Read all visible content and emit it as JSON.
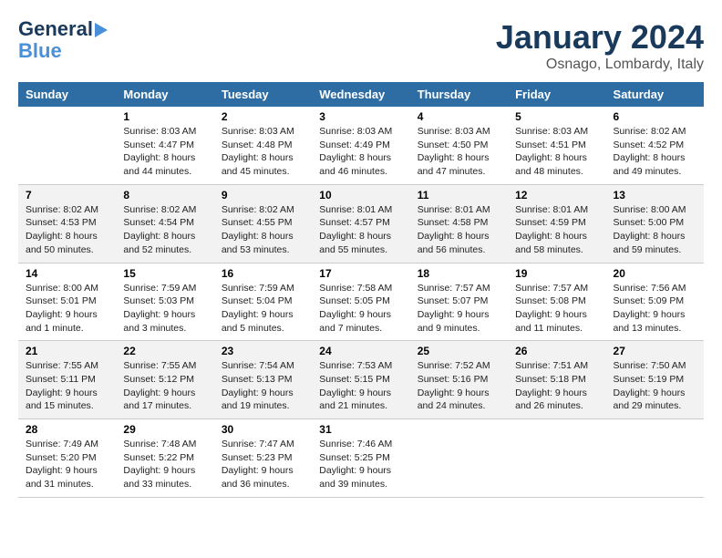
{
  "header": {
    "logo_line1": "General",
    "logo_line2": "Blue",
    "month": "January 2024",
    "location": "Osnago, Lombardy, Italy"
  },
  "columns": [
    "Sunday",
    "Monday",
    "Tuesday",
    "Wednesday",
    "Thursday",
    "Friday",
    "Saturday"
  ],
  "weeks": [
    [
      {
        "day": "",
        "info": ""
      },
      {
        "day": "1",
        "info": "Sunrise: 8:03 AM\nSunset: 4:47 PM\nDaylight: 8 hours\nand 44 minutes."
      },
      {
        "day": "2",
        "info": "Sunrise: 8:03 AM\nSunset: 4:48 PM\nDaylight: 8 hours\nand 45 minutes."
      },
      {
        "day": "3",
        "info": "Sunrise: 8:03 AM\nSunset: 4:49 PM\nDaylight: 8 hours\nand 46 minutes."
      },
      {
        "day": "4",
        "info": "Sunrise: 8:03 AM\nSunset: 4:50 PM\nDaylight: 8 hours\nand 47 minutes."
      },
      {
        "day": "5",
        "info": "Sunrise: 8:03 AM\nSunset: 4:51 PM\nDaylight: 8 hours\nand 48 minutes."
      },
      {
        "day": "6",
        "info": "Sunrise: 8:02 AM\nSunset: 4:52 PM\nDaylight: 8 hours\nand 49 minutes."
      }
    ],
    [
      {
        "day": "7",
        "info": "Sunrise: 8:02 AM\nSunset: 4:53 PM\nDaylight: 8 hours\nand 50 minutes."
      },
      {
        "day": "8",
        "info": "Sunrise: 8:02 AM\nSunset: 4:54 PM\nDaylight: 8 hours\nand 52 minutes."
      },
      {
        "day": "9",
        "info": "Sunrise: 8:02 AM\nSunset: 4:55 PM\nDaylight: 8 hours\nand 53 minutes."
      },
      {
        "day": "10",
        "info": "Sunrise: 8:01 AM\nSunset: 4:57 PM\nDaylight: 8 hours\nand 55 minutes."
      },
      {
        "day": "11",
        "info": "Sunrise: 8:01 AM\nSunset: 4:58 PM\nDaylight: 8 hours\nand 56 minutes."
      },
      {
        "day": "12",
        "info": "Sunrise: 8:01 AM\nSunset: 4:59 PM\nDaylight: 8 hours\nand 58 minutes."
      },
      {
        "day": "13",
        "info": "Sunrise: 8:00 AM\nSunset: 5:00 PM\nDaylight: 8 hours\nand 59 minutes."
      }
    ],
    [
      {
        "day": "14",
        "info": "Sunrise: 8:00 AM\nSunset: 5:01 PM\nDaylight: 9 hours\nand 1 minute."
      },
      {
        "day": "15",
        "info": "Sunrise: 7:59 AM\nSunset: 5:03 PM\nDaylight: 9 hours\nand 3 minutes."
      },
      {
        "day": "16",
        "info": "Sunrise: 7:59 AM\nSunset: 5:04 PM\nDaylight: 9 hours\nand 5 minutes."
      },
      {
        "day": "17",
        "info": "Sunrise: 7:58 AM\nSunset: 5:05 PM\nDaylight: 9 hours\nand 7 minutes."
      },
      {
        "day": "18",
        "info": "Sunrise: 7:57 AM\nSunset: 5:07 PM\nDaylight: 9 hours\nand 9 minutes."
      },
      {
        "day": "19",
        "info": "Sunrise: 7:57 AM\nSunset: 5:08 PM\nDaylight: 9 hours\nand 11 minutes."
      },
      {
        "day": "20",
        "info": "Sunrise: 7:56 AM\nSunset: 5:09 PM\nDaylight: 9 hours\nand 13 minutes."
      }
    ],
    [
      {
        "day": "21",
        "info": "Sunrise: 7:55 AM\nSunset: 5:11 PM\nDaylight: 9 hours\nand 15 minutes."
      },
      {
        "day": "22",
        "info": "Sunrise: 7:55 AM\nSunset: 5:12 PM\nDaylight: 9 hours\nand 17 minutes."
      },
      {
        "day": "23",
        "info": "Sunrise: 7:54 AM\nSunset: 5:13 PM\nDaylight: 9 hours\nand 19 minutes."
      },
      {
        "day": "24",
        "info": "Sunrise: 7:53 AM\nSunset: 5:15 PM\nDaylight: 9 hours\nand 21 minutes."
      },
      {
        "day": "25",
        "info": "Sunrise: 7:52 AM\nSunset: 5:16 PM\nDaylight: 9 hours\nand 24 minutes."
      },
      {
        "day": "26",
        "info": "Sunrise: 7:51 AM\nSunset: 5:18 PM\nDaylight: 9 hours\nand 26 minutes."
      },
      {
        "day": "27",
        "info": "Sunrise: 7:50 AM\nSunset: 5:19 PM\nDaylight: 9 hours\nand 29 minutes."
      }
    ],
    [
      {
        "day": "28",
        "info": "Sunrise: 7:49 AM\nSunset: 5:20 PM\nDaylight: 9 hours\nand 31 minutes."
      },
      {
        "day": "29",
        "info": "Sunrise: 7:48 AM\nSunset: 5:22 PM\nDaylight: 9 hours\nand 33 minutes."
      },
      {
        "day": "30",
        "info": "Sunrise: 7:47 AM\nSunset: 5:23 PM\nDaylight: 9 hours\nand 36 minutes."
      },
      {
        "day": "31",
        "info": "Sunrise: 7:46 AM\nSunset: 5:25 PM\nDaylight: 9 hours\nand 39 minutes."
      },
      {
        "day": "",
        "info": ""
      },
      {
        "day": "",
        "info": ""
      },
      {
        "day": "",
        "info": ""
      }
    ]
  ]
}
